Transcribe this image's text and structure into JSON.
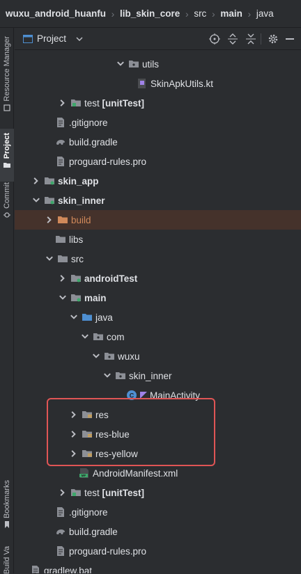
{
  "breadcrumb": [
    "wuxu_android_huanfu",
    "lib_skin_core",
    "src",
    "main",
    "java"
  ],
  "left_stripe": {
    "resource_manager": "Resource Manager",
    "project": "Project",
    "commit": "Commit",
    "bookmarks": "Bookmarks",
    "variants": "Build Variants"
  },
  "panel": {
    "title": "Project"
  },
  "tree": {
    "utils": "utils",
    "skinapkutils": "SkinApkUtils.kt",
    "test1": "test",
    "test1_tag": "[unitTest]",
    "gitignore1": ".gitignore",
    "buildgradle1": "build.gradle",
    "proguard1": "proguard-rules.pro",
    "skin_app": "skin_app",
    "skin_inner": "skin_inner",
    "build": "build",
    "libs": "libs",
    "src": "src",
    "androidTest": "androidTest",
    "main": "main",
    "java": "java",
    "com": "com",
    "wuxu": "wuxu",
    "skin_inner_pkg": "skin_inner",
    "mainactivity": "MainActivity",
    "res": "res",
    "res_blue": "res-blue",
    "res_yellow": "res-yellow",
    "manifest": "AndroidManifest.xml",
    "test2": "test",
    "test2_tag": "[unitTest]",
    "gitignore2": ".gitignore",
    "buildgradle2": "build.gradle",
    "proguard2": "proguard-rules.pro",
    "gradlew": "gradlew.bat"
  },
  "colors": {
    "highlight_border": "#e05555",
    "excluded": "#d0895a",
    "folder": "#8c8f96",
    "java_folder": "#4e8fd1"
  }
}
